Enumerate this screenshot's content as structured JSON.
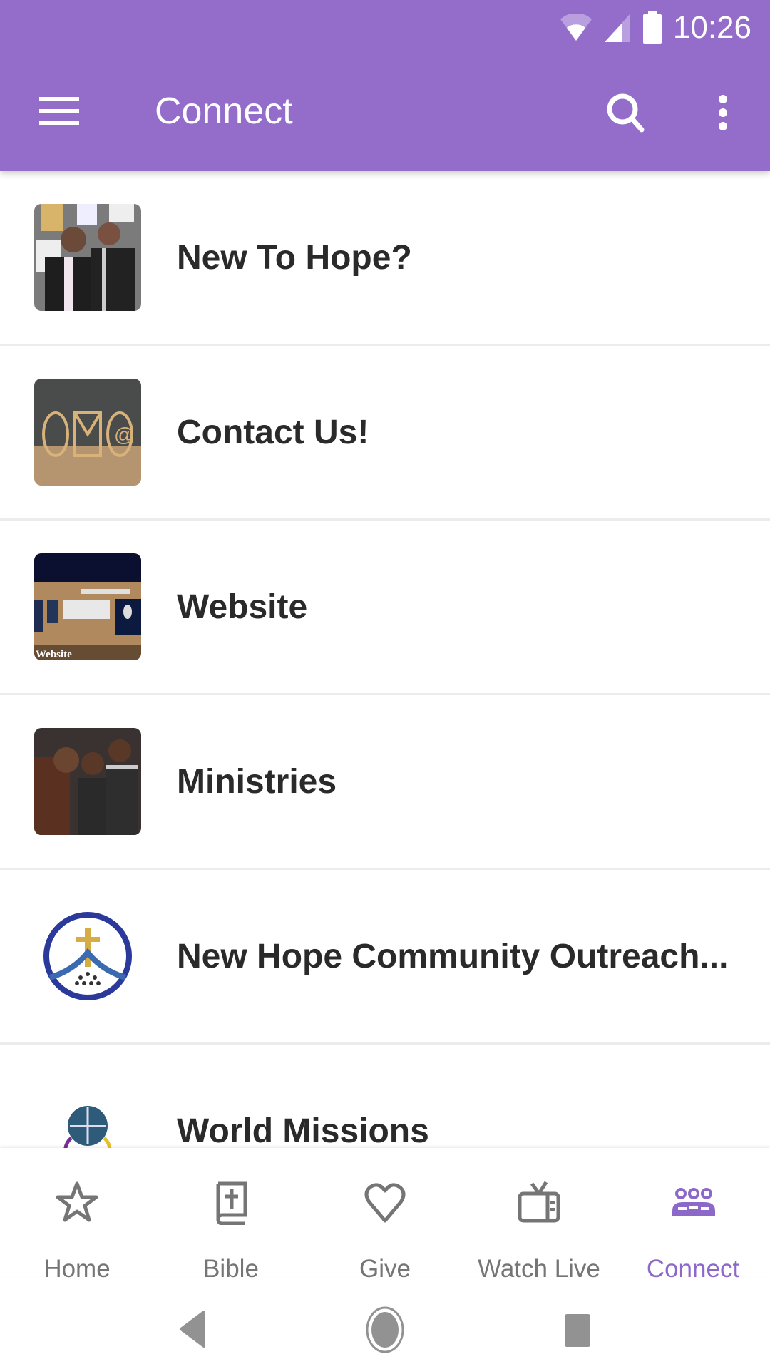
{
  "status_bar": {
    "time": "10:26",
    "icons": [
      "wifi-icon",
      "cell-signal-icon",
      "battery-icon"
    ]
  },
  "app_bar": {
    "title": "Connect",
    "background": "#946dcb",
    "icons": [
      "menu-icon",
      "search-icon",
      "more-vert-icon"
    ]
  },
  "list": {
    "items": [
      {
        "label": "New To Hope?",
        "thumb": "photo-couple-thumbnail"
      },
      {
        "label": "Contact Us!",
        "thumb": "photo-contact-symbols-thumbnail"
      },
      {
        "label": "Website",
        "thumb": "photo-desk-thumbnail",
        "thumb_caption": "Website"
      },
      {
        "label": "Ministries",
        "thumb": "photo-group-thumbnail"
      },
      {
        "label": "New Hope Community Outreach...",
        "thumb": "outreach-logo"
      },
      {
        "label": "World Missions",
        "thumb": "world-missions-logo"
      }
    ]
  },
  "bottom_nav": {
    "active_color": "#8c68c8",
    "inactive_color": "#757575",
    "items": [
      {
        "label": "Home",
        "icon": "star-icon",
        "active": false
      },
      {
        "label": "Bible",
        "icon": "bible-icon",
        "active": false
      },
      {
        "label": "Give",
        "icon": "heart-icon",
        "active": false
      },
      {
        "label": "Watch Live",
        "icon": "tv-icon",
        "active": false
      },
      {
        "label": "Connect",
        "icon": "group-icon",
        "active": true
      }
    ]
  },
  "system_nav": [
    "back-icon",
    "home-circle-icon",
    "recents-icon"
  ]
}
